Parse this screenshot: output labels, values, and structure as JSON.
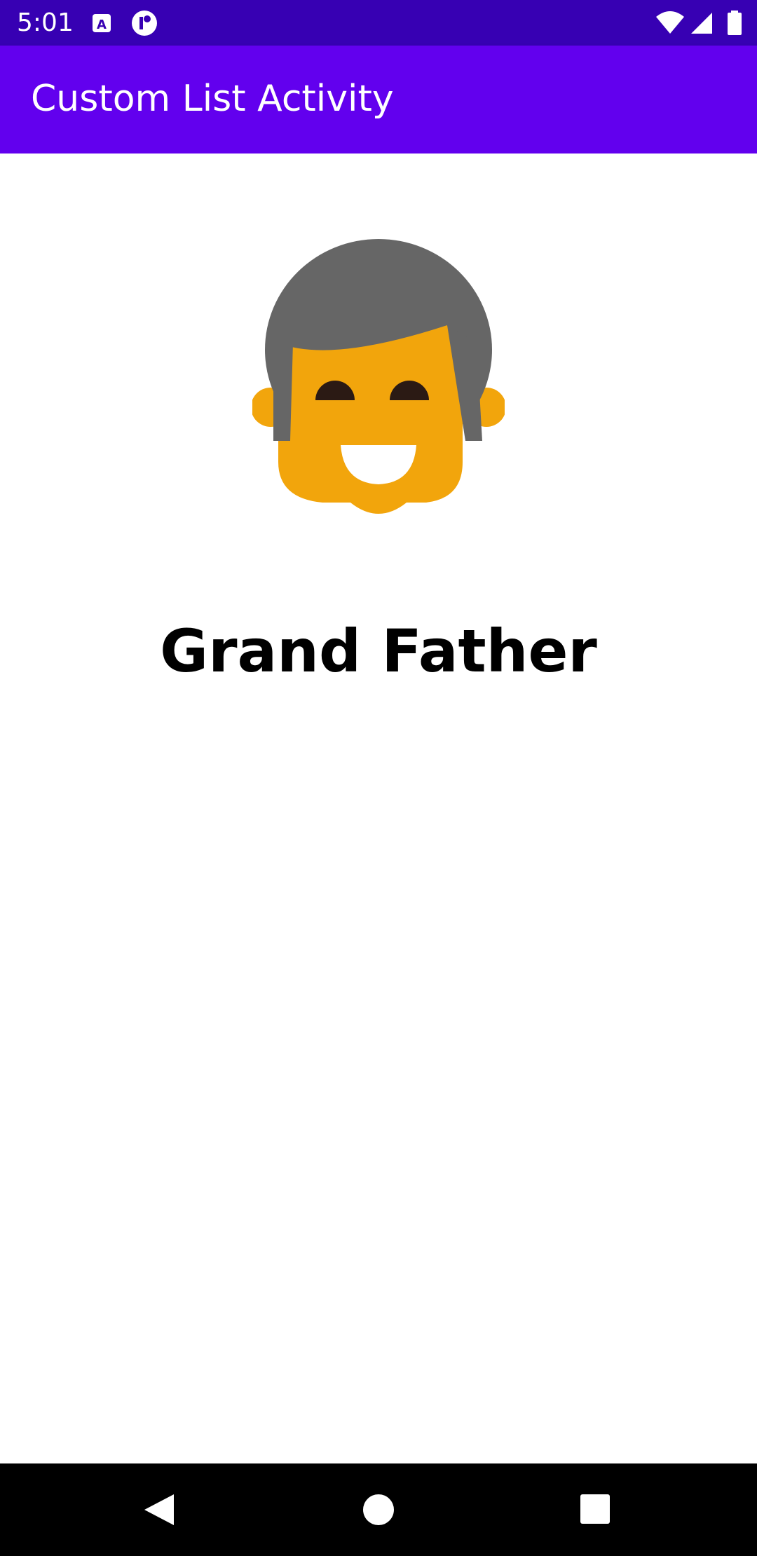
{
  "status_bar": {
    "time": "5:01",
    "icons": [
      "accessibility-a-icon",
      "app-notification-icon",
      "wifi-icon",
      "signal-icon",
      "battery-icon"
    ],
    "background": "#3700b3"
  },
  "app_bar": {
    "title": "Custom List Activity",
    "background": "#6200ee"
  },
  "main": {
    "avatar_icon": "grandfather-face-icon",
    "name": "Grand Father"
  },
  "nav_bar": {
    "buttons": [
      "back-icon",
      "home-icon",
      "recents-icon"
    ]
  }
}
